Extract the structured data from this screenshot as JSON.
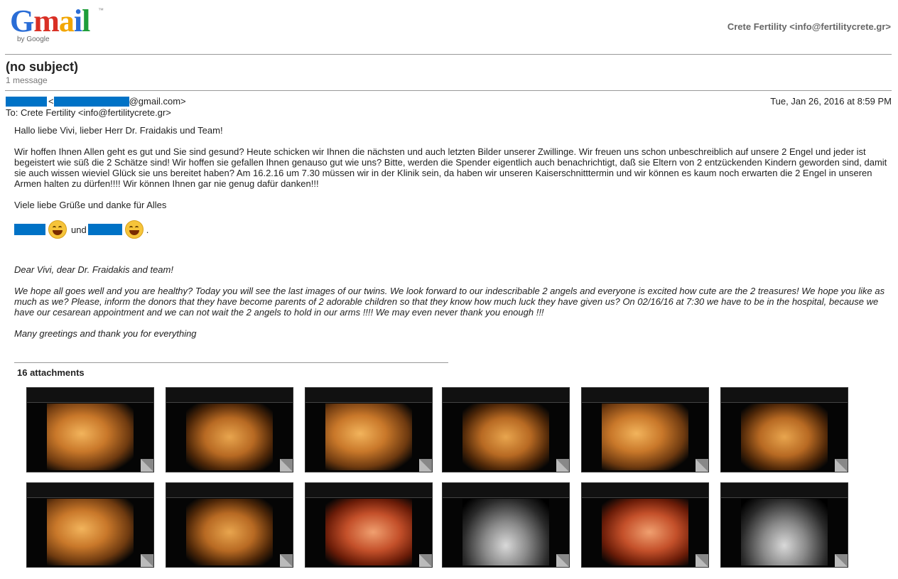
{
  "header": {
    "logo_text": "Gmail",
    "logo_sub": "by Google",
    "account": "Crete Fertility <info@fertilitycrete.gr>"
  },
  "thread": {
    "subject": "(no subject)",
    "message_count": "1 message"
  },
  "message": {
    "from_pre": "<",
    "from_domain": "@gmail.com>",
    "to": "To: Crete Fertility <info@fertilitycrete.gr>",
    "date": "Tue, Jan 26, 2016 at 8:59 PM",
    "de_greeting": "Hallo liebe Vivi, lieber Herr Dr. Fraidakis und Team!",
    "de_body": "Wir hoffen Ihnen Allen geht es gut und Sie sind gesund? Heute schicken wir Ihnen die nächsten und auch letzten Bilder unserer Zwillinge. Wir freuen uns schon unbeschreiblich auf unsere 2 Engel und jeder ist begeistert wie süß die 2 Schätze sind! Wir hoffen sie gefallen Ihnen genauso gut wie uns? Bitte, werden die Spender eigentlich auch benachrichtigt, daß sie Eltern von 2 entzückenden Kindern geworden sind, damit sie auch wissen wieviel Glück sie uns bereitet haben? Am 16.2.16 um 7.30 müssen wir in der Klinik sein, da haben wir unseren Kaiserschnitttermin und wir können es kaum noch erwarten die 2 Engel in unseren Armen halten zu dürfen!!!! Wir können Ihnen gar nie genug dafür danken!!!",
    "de_closing": "Viele liebe Grüße und danke für Alles",
    "sig_and": "und",
    "sig_end": ".",
    "en_greeting": "Dear Vivi, dear Dr. Fraidakis and team!",
    "en_body": "We hope all goes well and you are healthy? Today you will see the last images of our twins. We look forward to our indescribable 2 angels and everyone is excited how cute are the 2 treasures! We hope you like as much as we? Please, inform the donors that they have become parents of 2 adorable children so that they know how much luck they have given us? On 02/16/16 at 7:30 we have to be in the hospital, because we have our cesarean appointment and we can not wait the 2 angels to hold in our arms !!!! We may even never thank you enough !!!",
    "en_closing": "Many greetings and thank you for everything"
  },
  "attachments": {
    "title": "16 attachments"
  }
}
